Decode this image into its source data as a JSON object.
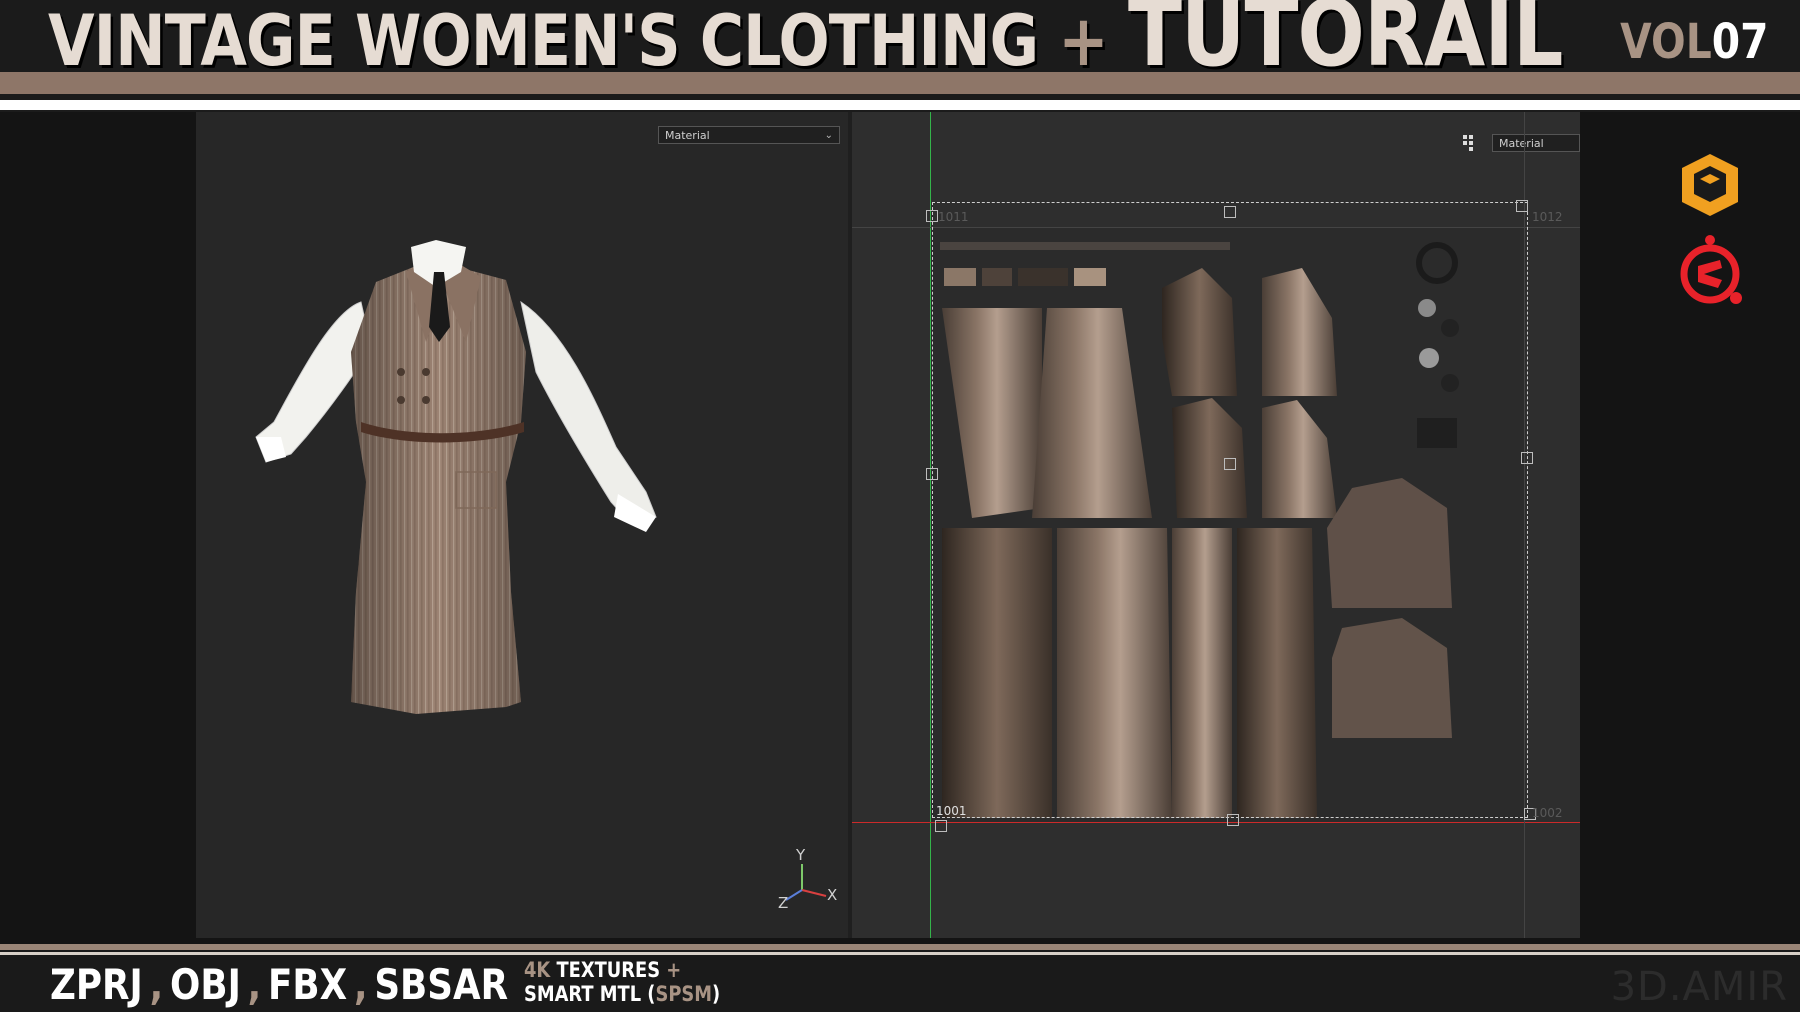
{
  "banner": {
    "title_part1": "VINTAGE WOMEN'S CLOTHING",
    "title_plus": "+",
    "title_part2": "TUTORAIL",
    "vol_label": "VOL",
    "vol_number": "07"
  },
  "viewport3d": {
    "dropdown_value": "Material",
    "axis_x": "X",
    "axis_y": "Y",
    "axis_z": "Z"
  },
  "uv_editor": {
    "dropdown_value": "Material",
    "tile_label_main": "1001",
    "tile_label_top_left": "1011",
    "tile_label_top_right": "1012",
    "tile_label_bottom_right": "1002"
  },
  "apps": {
    "app1_icon": "marvelous-designer-cube-icon",
    "app2_icon": "substance-painter-icon",
    "app1_color": "#f0a020",
    "app2_color": "#e8222a"
  },
  "footer": {
    "formats": [
      "ZPRJ",
      "OBJ",
      "FBX",
      "SBSAR"
    ],
    "sep": ",",
    "tex_4k": "4K",
    "tex_textures": "TEXTURES",
    "tex_plus": "+",
    "smart_mtl": "SMART MTL",
    "spsm_open": "(",
    "spsm": "SPSM",
    "spsm_close": ")",
    "watermark": "3D.AMIR"
  }
}
